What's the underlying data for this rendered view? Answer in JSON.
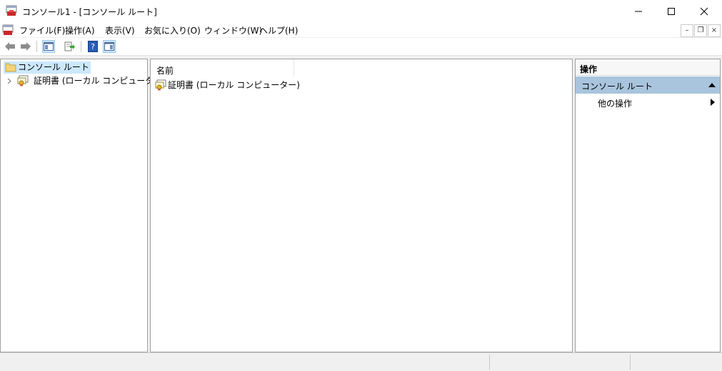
{
  "window": {
    "title": "コンソール1 - [コンソール ルート]"
  },
  "menu": {
    "items": [
      "ファイル(F)",
      "操作(A)",
      "表示(V)",
      "お気に入り(O)",
      "ウィンドウ(W)",
      "ヘルプ(H)"
    ]
  },
  "tree": {
    "root_label": "コンソール ルート",
    "child_label": "証明書 (ローカル コンピューター)"
  },
  "list": {
    "column_name": "名前",
    "rows": [
      "証明書 (ローカル コンピューター)"
    ]
  },
  "actions": {
    "header": "操作",
    "group_label": "コンソール ルート",
    "more_actions": "他の操作"
  },
  "colors": {
    "selection": "#cce8ff",
    "action_group": "#a9c4dd",
    "toolbar_active": "#cce4f7"
  }
}
